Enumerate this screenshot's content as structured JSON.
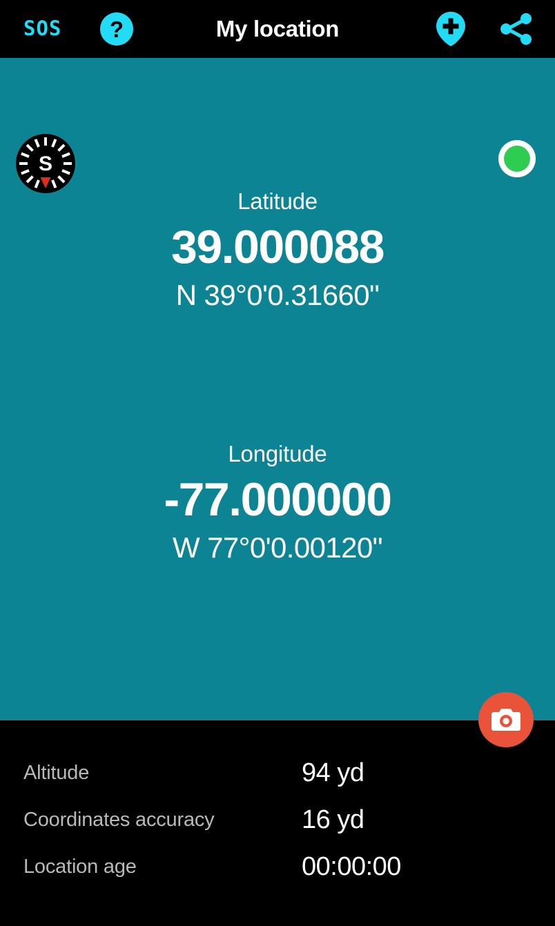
{
  "appbar": {
    "sos_label": "SOS",
    "help_icon": "question-mark-circle-icon",
    "title": "My location",
    "add_pin_icon": "add-location-pin-icon",
    "share_icon": "share-icon"
  },
  "main": {
    "compass": {
      "icon": "compass-icon",
      "heading_letter": "S",
      "needle_color": "#E02B20",
      "dial_color": "#000000",
      "tick_color": "#FFFFFF"
    },
    "gps_status": {
      "icon": "gps-status-dot-icon",
      "color": "#2ECC50",
      "ring_color": "#FFFFFF"
    },
    "coordinates": [
      {
        "id": "latitude",
        "label": "Latitude",
        "value": "39.000088",
        "dms": "N 39°0'0.31660\""
      },
      {
        "id": "longitude",
        "label": "Longitude",
        "value": "-77.000000",
        "dms": "W 77°0'0.00120\""
      }
    ],
    "camera_button": {
      "icon": "camera-icon",
      "color": "#E8533A"
    }
  },
  "info": {
    "rows": [
      {
        "label": "Altitude",
        "value": "94 yd"
      },
      {
        "label": "Coordinates accuracy",
        "value": "16 yd"
      },
      {
        "label": "Location age",
        "value": "00:00:00"
      }
    ]
  },
  "colors": {
    "accent_cyan": "#22DBF4",
    "panel_teal": "#0D8494",
    "background_black": "#000000",
    "fab_orange": "#E8533A",
    "status_green": "#2ECC50",
    "label_gray": "#B9B9B9"
  }
}
